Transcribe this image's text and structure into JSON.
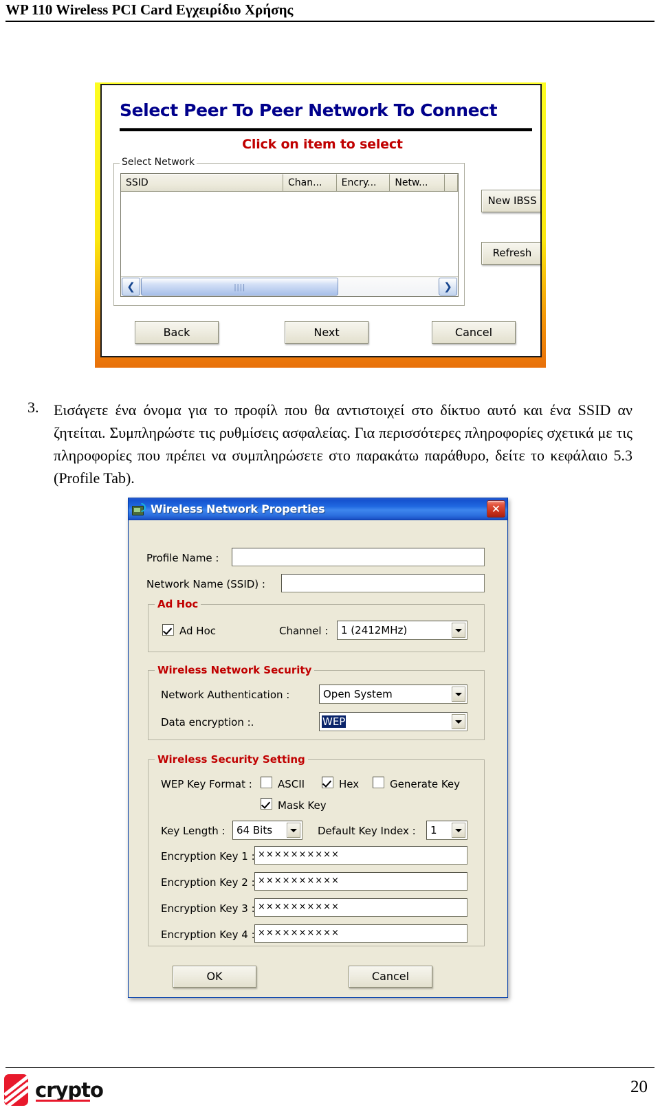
{
  "header": {
    "title": "WP 110 Wireless PCI Card Εγχειρίδιο Χρήσης"
  },
  "dialog_peer": {
    "title": "Select Peer To Peer Network To Connect",
    "subtitle": "Click on item to select",
    "group_label": "Select Network",
    "columns": [
      "SSID",
      "Chan...",
      "Encry...",
      "Netw...",
      ""
    ],
    "rows": [],
    "scrollbar": {
      "left_arrow": "❮",
      "right_arrow": "❯",
      "grip": "||||"
    },
    "side_buttons": [
      {
        "label": "New IBSS"
      },
      {
        "label": "Refresh"
      }
    ],
    "footer_buttons": [
      {
        "label": "Back"
      },
      {
        "label": "Next"
      },
      {
        "label": "Cancel"
      }
    ]
  },
  "instruction": {
    "number": "3.",
    "text": "Εισάγετε ένα όνομα για το προφίλ που θα αντιστοιχεί στο δίκτυο αυτό και ένα SSID αν ζητείται. Συμπληρώστε τις ρυθμίσεις ασφαλείας. Για περισσότερες πληροφορίες σχετικά με τις πληροφορίες που πρέπει να συμπληρώσετε στο παρακάτω παράθυρο, δείτε το κεφάλαιο 5.3 (Profile Tab)."
  },
  "dialog_props": {
    "title": "Wireless Network Properties",
    "close_label": "✕",
    "profile_name": {
      "label": "Profile Name :",
      "value": ""
    },
    "network_name": {
      "label": "Network Name (SSID) :",
      "value": ""
    },
    "adhoc_group": {
      "label": "Ad Hoc",
      "checkbox_label": "Ad Hoc",
      "checkbox_checked": true,
      "channel_label": "Channel :",
      "channel_value": "1  (2412MHz)"
    },
    "security_group": {
      "label": "Wireless Network Security",
      "auth_label": "Network Authentication :",
      "auth_value": "Open System",
      "encryption_label": "Data encryption :.",
      "encryption_value": "WEP"
    },
    "security_setting_group": {
      "label": "Wireless Security Setting",
      "wep_key_format_label": "WEP Key Format :",
      "ascii_label": "ASCII",
      "ascii_checked": false,
      "hex_label": "Hex",
      "hex_checked": true,
      "generate_key_label": "Generate Key",
      "generate_key_checked": false,
      "mask_key_label": "Mask Key",
      "mask_key_checked": true,
      "key_length_label": "Key Length :",
      "key_length_value": "64 Bits",
      "default_key_index_label": "Default Key Index :",
      "default_key_index_value": "1",
      "keys": [
        {
          "label": "Encryption Key 1 :",
          "value": "××××××××××"
        },
        {
          "label": "Encryption Key 2 :",
          "value": "××××××××××"
        },
        {
          "label": "Encryption Key 3 :",
          "value": "××××××××××"
        },
        {
          "label": "Encryption Key 4 :",
          "value": "××××××××××"
        }
      ]
    },
    "ok_label": "OK",
    "cancel_label": "Cancel"
  },
  "footer": {
    "logo_text": "crypto",
    "page_number": "20"
  },
  "colors": {
    "dialog_border_gradient_start": "#fdfd22",
    "dialog_border_gradient_end": "#e8700a",
    "peer_title_blue": "#00008B",
    "alert_red": "#C00000",
    "titlebar_blue": "#1f68e0",
    "close_red": "#c7301b",
    "selection_blue": "#0a246a",
    "logo_red": "#E8192C",
    "dialog_face": "#ece9d8"
  }
}
